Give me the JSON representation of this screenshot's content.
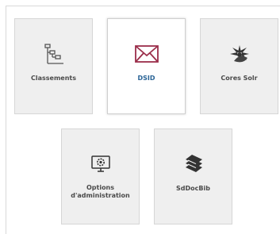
{
  "tiles": [
    {
      "label": "Classements",
      "icon": "hierarchy-tree-icon",
      "selected": false
    },
    {
      "label": "DSID",
      "icon": "envelope-icon",
      "selected": true
    },
    {
      "label": "Cores Solr",
      "icon": "solr-sun-icon",
      "selected": false
    },
    {
      "label": "Options\nd'administration",
      "icon": "monitor-gear-icon",
      "selected": false
    },
    {
      "label": "SdDocBib",
      "icon": "book-stack-icon",
      "selected": false
    }
  ],
  "colors": {
    "selected_label": "#2a6496",
    "envelope_accent": "#9b2e4a",
    "icon_default": "#444444",
    "tile_background": "#efefef"
  }
}
